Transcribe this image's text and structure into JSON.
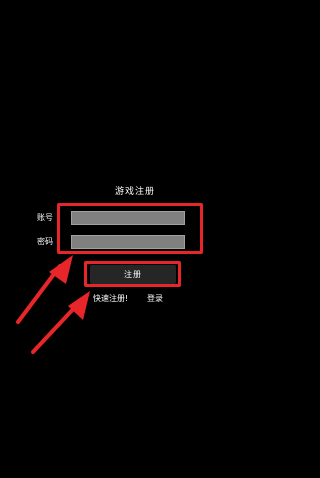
{
  "form": {
    "title": "游戏注册",
    "account_label": "账号",
    "password_label": "密码",
    "account_value": "",
    "password_value": "",
    "register_button": "注册",
    "quick_register_link": "快速注册!",
    "login_link": "登录"
  },
  "annotations": {
    "highlight_color": "#e8262a",
    "arrow_color": "#e8262a"
  }
}
